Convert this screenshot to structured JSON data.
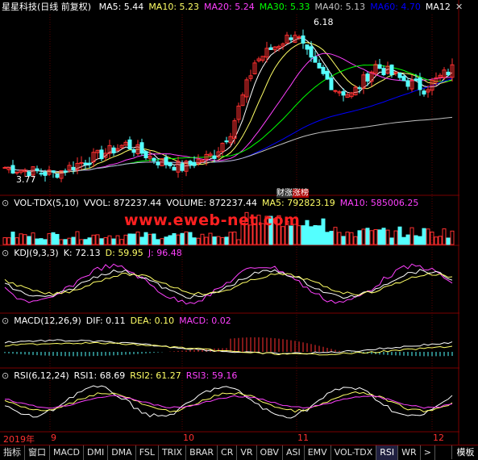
{
  "window": {
    "title": "星星科技(日线 前复权)"
  },
  "main_panel": {
    "ma_labels": [
      {
        "text": "MA5: 5.44",
        "color": "#ffffff"
      },
      {
        "text": "MA10: 5.23",
        "color": "#ffff66"
      },
      {
        "text": "MA20: 5.24",
        "color": "#ff40ff"
      },
      {
        "text": "MA30: 5.33",
        "color": "#00ff00"
      },
      {
        "text": "MA40: 5.13",
        "color": "#c0c0c0"
      },
      {
        "text": "MA60: 4.70",
        "color": "#0000ff"
      },
      {
        "text": "MA12",
        "color": "#ffffff"
      }
    ],
    "high_label": "6.18",
    "low_label": "3.77",
    "tags": [
      "财涨",
      "涨榜"
    ]
  },
  "vol_panel": {
    "title": "VOL-TDX(5,10)",
    "labels": [
      {
        "text": "VVOL: 872237.44",
        "color": "#ffffff"
      },
      {
        "text": "VOLUME: 872237.44",
        "color": "#ffffff"
      },
      {
        "text": "MA5: 792823.19",
        "color": "#ffff66"
      },
      {
        "text": "MA10: 585006.25",
        "color": "#ff40ff"
      }
    ]
  },
  "kdj_panel": {
    "title": "KDJ(9,3,3)",
    "labels": [
      {
        "text": "K: 72.13",
        "color": "#ffffff"
      },
      {
        "text": "D: 59.95",
        "color": "#ffff66"
      },
      {
        "text": "J: 96.48",
        "color": "#ff40ff"
      }
    ]
  },
  "macd_panel": {
    "title": "MACD(12,26,9)",
    "labels": [
      {
        "text": "DIF: 0.11",
        "color": "#ffffff"
      },
      {
        "text": "DEA: 0.10",
        "color": "#ffff66"
      },
      {
        "text": "MACD: 0.02",
        "color": "#ff40ff"
      }
    ]
  },
  "rsi_panel": {
    "title": "RSI(6,12,24)",
    "labels": [
      {
        "text": "RSI1: 68.69",
        "color": "#ffffff"
      },
      {
        "text": "RSI2: 61.27",
        "color": "#ffff66"
      },
      {
        "text": "RSI3: 59.16",
        "color": "#ff40ff"
      }
    ]
  },
  "date_axis": [
    "2019年",
    "9",
    "10",
    "11",
    "12"
  ],
  "watermark": "www.eweb-net.com",
  "bottom_tabs": [
    "指标",
    "窗口",
    "MACD",
    "DMI",
    "DMA",
    "FSL",
    "TRIX",
    "BRAR",
    "CR",
    "VR",
    "OBV",
    "ASI",
    "EMV",
    "VOL-TDX",
    "RSI",
    "WR",
    ">"
  ],
  "active_tab": "RSI",
  "right_button": "模板",
  "colors": {
    "up": "#ff3030",
    "down": "#54ffff",
    "grid": "#7a0000"
  }
}
